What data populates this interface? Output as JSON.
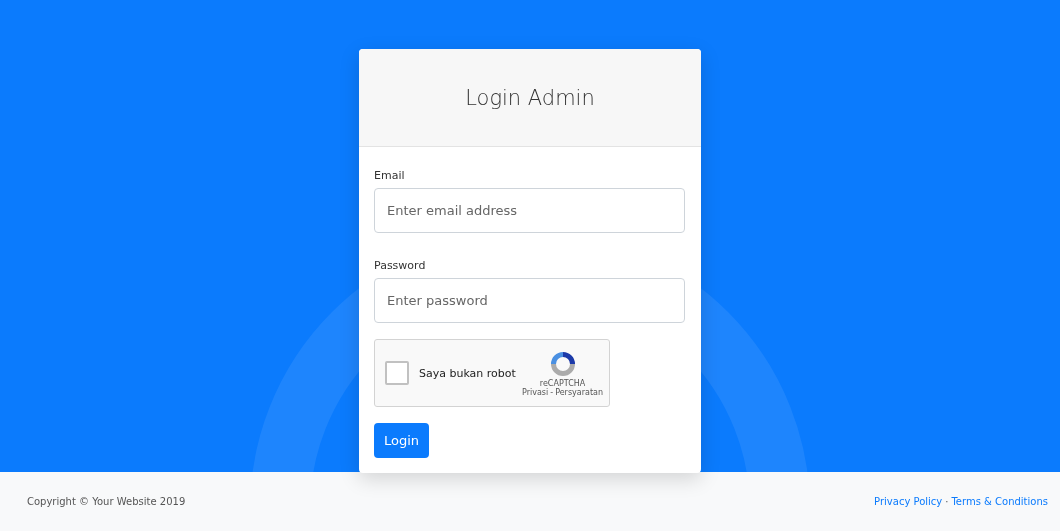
{
  "login_card": {
    "title": "Login Admin",
    "email": {
      "label": "Email",
      "placeholder": "Enter email address"
    },
    "password": {
      "label": "Password",
      "placeholder": "Enter password"
    },
    "captcha": {
      "checked": false,
      "label": "Saya bukan robot",
      "brand": "reCAPTCHA",
      "privacy": "Privasi",
      "separator": "-",
      "terms": "Persyaratan"
    },
    "button": "Login"
  },
  "footer": {
    "copyright": "Copyright © Your Website 2019",
    "links": [
      {
        "label": "Privacy Policy"
      },
      {
        "label": "Terms & Conditions"
      }
    ],
    "separator": "·"
  }
}
